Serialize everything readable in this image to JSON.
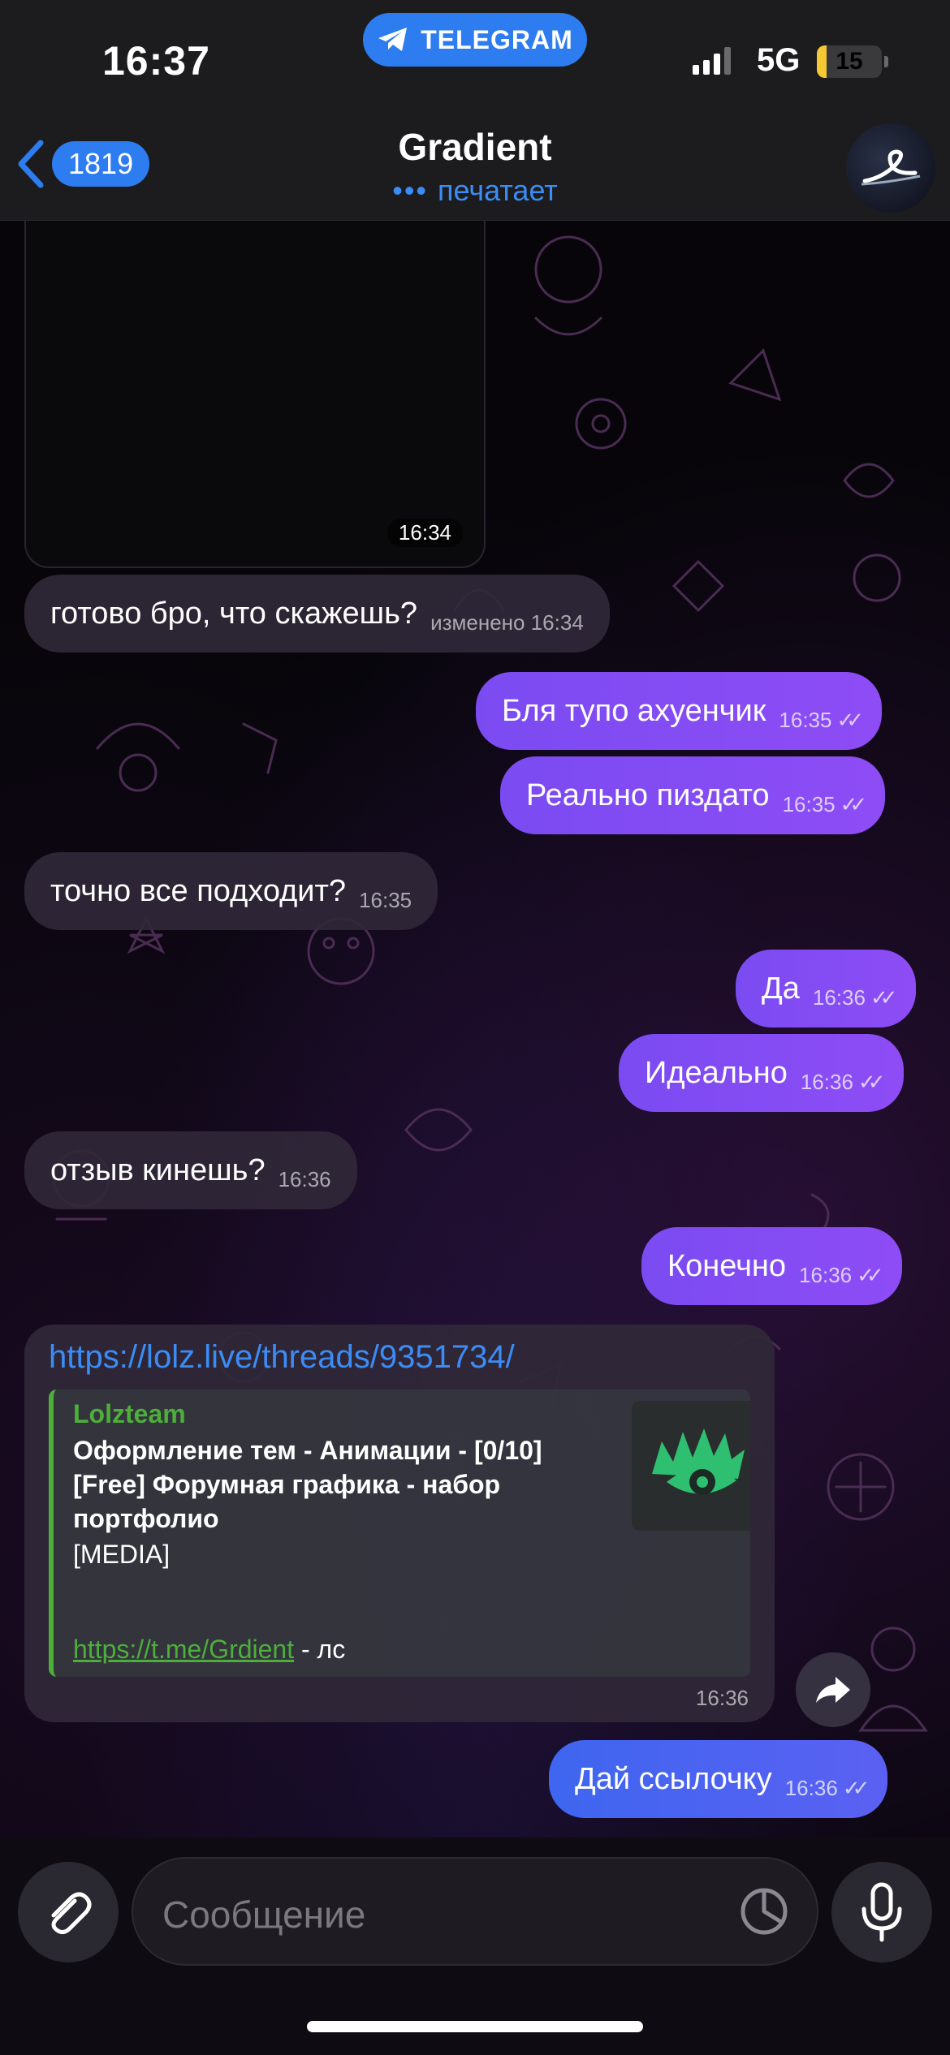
{
  "status_bar": {
    "time": "16:37",
    "app_pill": "TELEGRAM",
    "network": "5G",
    "battery": "15",
    "battery_level": 0.15
  },
  "header": {
    "back_count": "1819",
    "title": "Gradient",
    "subtitle": "печатает",
    "accent_color": "#2d7df0"
  },
  "messages": [
    {
      "type": "media",
      "direction": "incoming",
      "time": "16:34"
    },
    {
      "type": "text",
      "direction": "incoming",
      "text": "готово бро, что скажешь?",
      "meta": "изменено 16:34"
    },
    {
      "type": "text",
      "direction": "outgoing",
      "text": "Бля тупо ахуенчик",
      "meta": "16:35",
      "read": true
    },
    {
      "type": "text",
      "direction": "outgoing",
      "text": "Реально пиздато",
      "meta": "16:35",
      "read": true
    },
    {
      "type": "text",
      "direction": "incoming",
      "text": "точно все подходит?",
      "meta": "16:35"
    },
    {
      "type": "text",
      "direction": "outgoing",
      "text": "Да",
      "meta": "16:36",
      "read": true
    },
    {
      "type": "text",
      "direction": "outgoing",
      "text": "Идеально",
      "meta": "16:36",
      "read": true
    },
    {
      "type": "text",
      "direction": "incoming",
      "text": "отзыв кинешь?",
      "meta": "16:36"
    },
    {
      "type": "text",
      "direction": "outgoing",
      "text": "Конечно",
      "meta": "16:36",
      "read": true
    },
    {
      "type": "link",
      "direction": "incoming",
      "url": "https://lolz.live/threads/9351734/",
      "preview": {
        "site": "Lolzteam",
        "title": "Оформление тем - Анимации - [0/10] [Free] Форумная графика - набор портфолио",
        "description": "[MEDIA]",
        "link": "https://t.me/Grdient",
        "link_suffix": " - лс"
      },
      "time": "16:36"
    },
    {
      "type": "text",
      "direction": "outgoing",
      "text": "Дай ссылочку",
      "meta": "16:36",
      "read": true
    }
  ],
  "read_ticks": "✓✓",
  "input": {
    "placeholder": "Сообщение"
  },
  "colors": {
    "outgoing_bubble": "#8a4cf4",
    "outgoing_bubble_last": "#4a64f0",
    "incoming_bubble": "#302838",
    "link_color": "#3b8df5",
    "preview_accent": "#4caf3a"
  },
  "icons": {
    "back": "chevron-left-icon",
    "telegram": "telegram-plane-icon",
    "attach": "paperclip-icon",
    "sticker": "sticker-icon",
    "mic": "microphone-icon",
    "share": "forward-arrow-icon"
  }
}
